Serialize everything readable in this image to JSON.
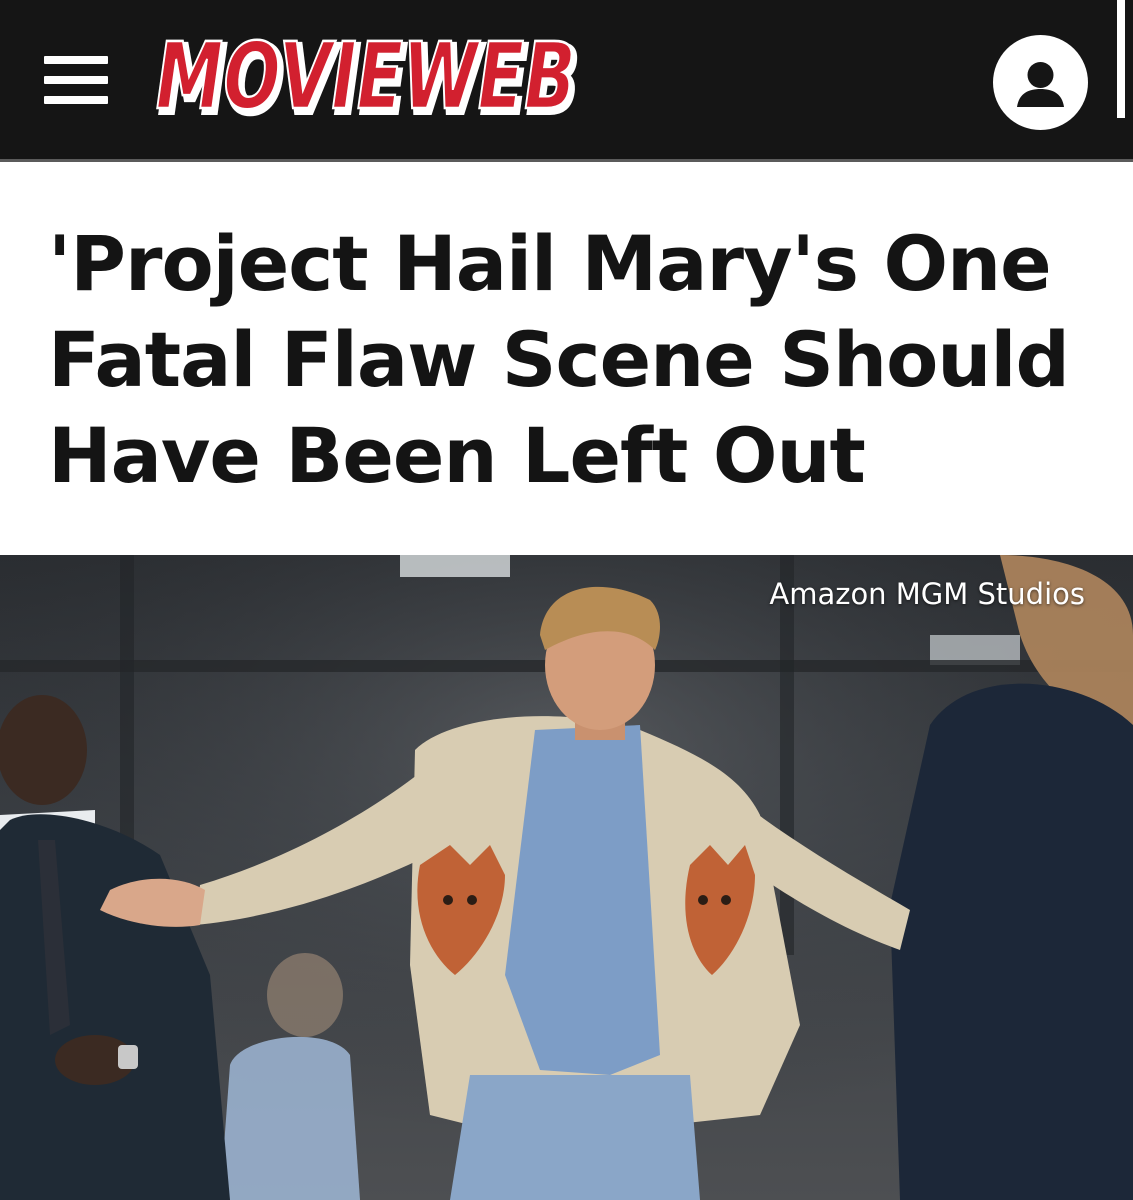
{
  "header": {
    "logo_text": "MOVIEWEB",
    "menu_icon": "hamburger-menu-icon",
    "account_icon": "user-account-icon",
    "brand_color": "#d2202f",
    "background_color": "#151515"
  },
  "article": {
    "title": "'Project Hail Mary's One Fatal Flaw Scene Should Have Been Left Out",
    "image_credit": "Amazon MGM Studios"
  }
}
